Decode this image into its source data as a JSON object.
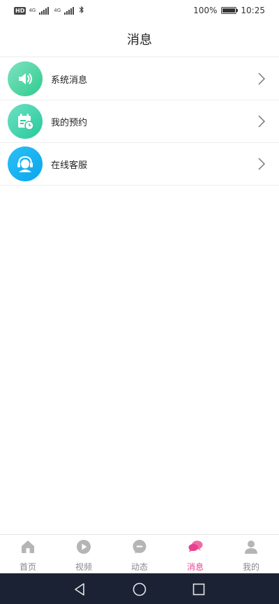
{
  "status_bar": {
    "badge": "HD",
    "network1": "4G",
    "network2": "4G",
    "battery": "100%",
    "battery_level": 1.0,
    "time": "10:25"
  },
  "header": {
    "title": "消息"
  },
  "list": [
    {
      "label": "系统消息",
      "icon": "speaker-icon"
    },
    {
      "label": "我的预约",
      "icon": "calendar-clock-icon"
    },
    {
      "label": "在线客服",
      "icon": "customer-service-icon"
    }
  ],
  "tabs": [
    {
      "label": "首页",
      "icon": "home-icon",
      "active": false
    },
    {
      "label": "视频",
      "icon": "play-icon",
      "active": false
    },
    {
      "label": "动态",
      "icon": "chat-bubble-icon",
      "active": false
    },
    {
      "label": "消息",
      "icon": "messages-icon",
      "active": true
    },
    {
      "label": "我的",
      "icon": "person-icon",
      "active": false
    }
  ],
  "colors": {
    "active_tab": "#e8418f",
    "inactive_tab": "#888888",
    "nav_bar": "#1b2233"
  }
}
